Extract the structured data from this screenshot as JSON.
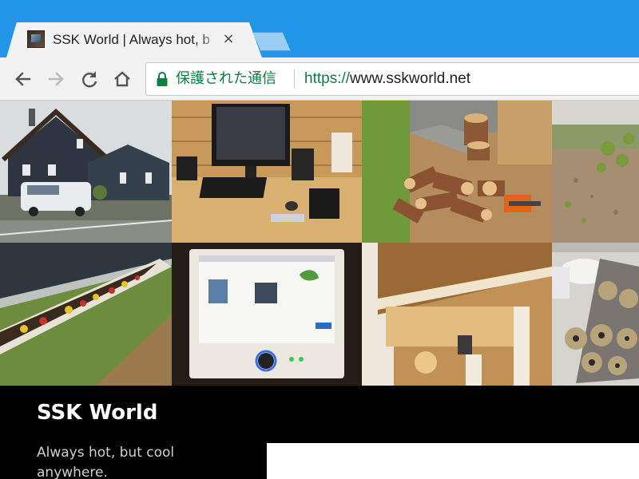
{
  "browser": {
    "tab": {
      "title": "SSK World | Always hot, b",
      "close_glyph": "×",
      "favicon": "site-favicon"
    },
    "new_tab": "new-tab-button",
    "nav": {
      "back_icon": "arrow-left-icon",
      "forward_icon": "arrow-right-icon",
      "reload_icon": "reload-icon",
      "home_icon": "home-icon"
    },
    "omnibox": {
      "security_icon": "lock-icon",
      "security_label": "保護された通信",
      "url_scheme": "https://",
      "url_host": "www.sskworld.net"
    },
    "colors": {
      "titlebar": "#2196e8",
      "toolbar": "#f2f2f2",
      "secure": "#0b8043"
    }
  },
  "page": {
    "photos": [
      {
        "name": "house-photo"
      },
      {
        "name": "desk-computer-photo"
      },
      {
        "name": "firewood-photo"
      },
      {
        "name": "garden-soil-photo"
      },
      {
        "name": "flower-bed-photo"
      },
      {
        "name": "control-panel-photo"
      },
      {
        "name": "wooden-shelf-photo"
      },
      {
        "name": "baking-tray-photo"
      }
    ],
    "site_title": "SSK World",
    "tagline": "Always hot, but cool anywhere."
  }
}
